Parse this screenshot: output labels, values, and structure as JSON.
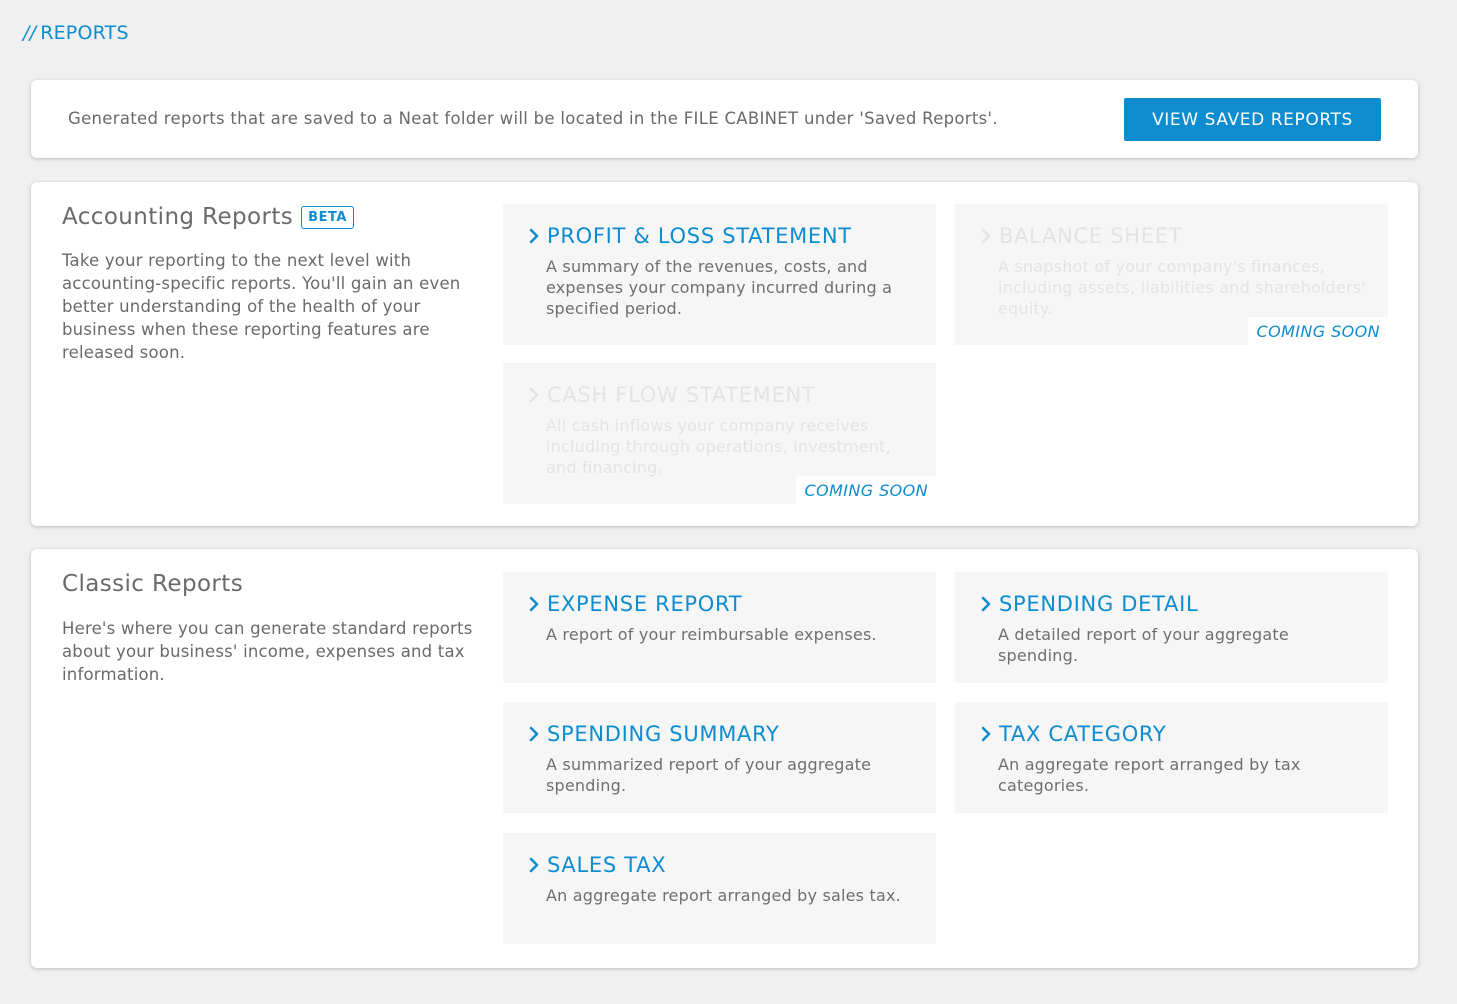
{
  "header": {
    "slashes": "//",
    "title": "REPORTS"
  },
  "info": {
    "text": "Generated reports that are saved to a Neat folder will be located in the FILE CABINET under 'Saved Reports'.",
    "button_label": "VIEW SAVED REPORTS"
  },
  "accounting": {
    "title": "Accounting Reports",
    "badge": "BETA",
    "description": "Take your reporting to the next level with accounting-specific reports. You'll gain an even better understanding of the health of your business when these reporting features are released soon.",
    "cards": [
      {
        "title": "PROFIT & LOSS STATEMENT",
        "description": "A summary of the revenues, costs, and expenses your company incurred during a specified period."
      },
      {
        "title": "BALANCE SHEET",
        "description": "A snapshot of your company's finances, including assets, liabilities and shareholders' equity.",
        "status": "COMING SOON"
      },
      {
        "title": "CASH FLOW STATEMENT",
        "description": "All cash inflows your company receives including through operations, investment, and financing.",
        "status": "COMING SOON"
      }
    ]
  },
  "classic": {
    "title": "Classic Reports",
    "description": "Here's where you can generate standard reports about your business' income, expenses and tax information.",
    "cards": [
      {
        "title": "EXPENSE REPORT",
        "description": "A report of your reimbursable expenses."
      },
      {
        "title": "SPENDING DETAIL",
        "description": "A detailed report of your aggregate spending."
      },
      {
        "title": "SPENDING SUMMARY",
        "description": "A summarized report of your aggregate spending."
      },
      {
        "title": "TAX CATEGORY",
        "description": "An aggregate report arranged by tax categories."
      },
      {
        "title": "SALES TAX",
        "description": "An aggregate report arranged by sales tax."
      }
    ]
  },
  "colors": {
    "accent": "#0d8cd0",
    "background": "#f0f0f0",
    "card": "#f6f6f6",
    "disabled_text": "#e3e3e3"
  }
}
